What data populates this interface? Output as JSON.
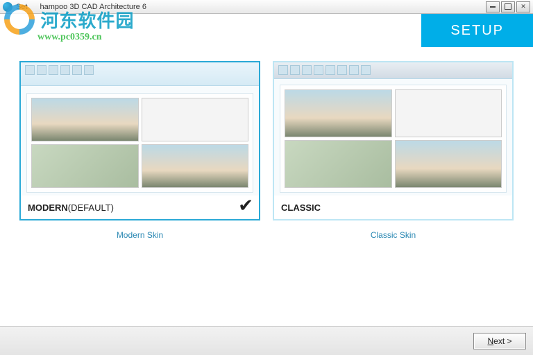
{
  "window": {
    "title_prefix": "Set",
    "title_main": "hampoo 3D CAD Architecture 6"
  },
  "watermark": {
    "site_name": "河东软件园",
    "site_url": "www.pc0359.cn"
  },
  "header": {
    "setup_label": "SETUP"
  },
  "options": {
    "modern": {
      "band_strong": "MODERN",
      "band_rest": " (DEFAULT)",
      "caption": "Modern Skin",
      "selected": true
    },
    "classic": {
      "band_strong": "CLASSIC",
      "band_rest": "",
      "caption": "Classic Skin",
      "selected": false
    }
  },
  "footer": {
    "next_underlined": "N",
    "next_rest": "ext >"
  },
  "colors": {
    "accent": "#00aee8",
    "link": "#2a88b3"
  }
}
